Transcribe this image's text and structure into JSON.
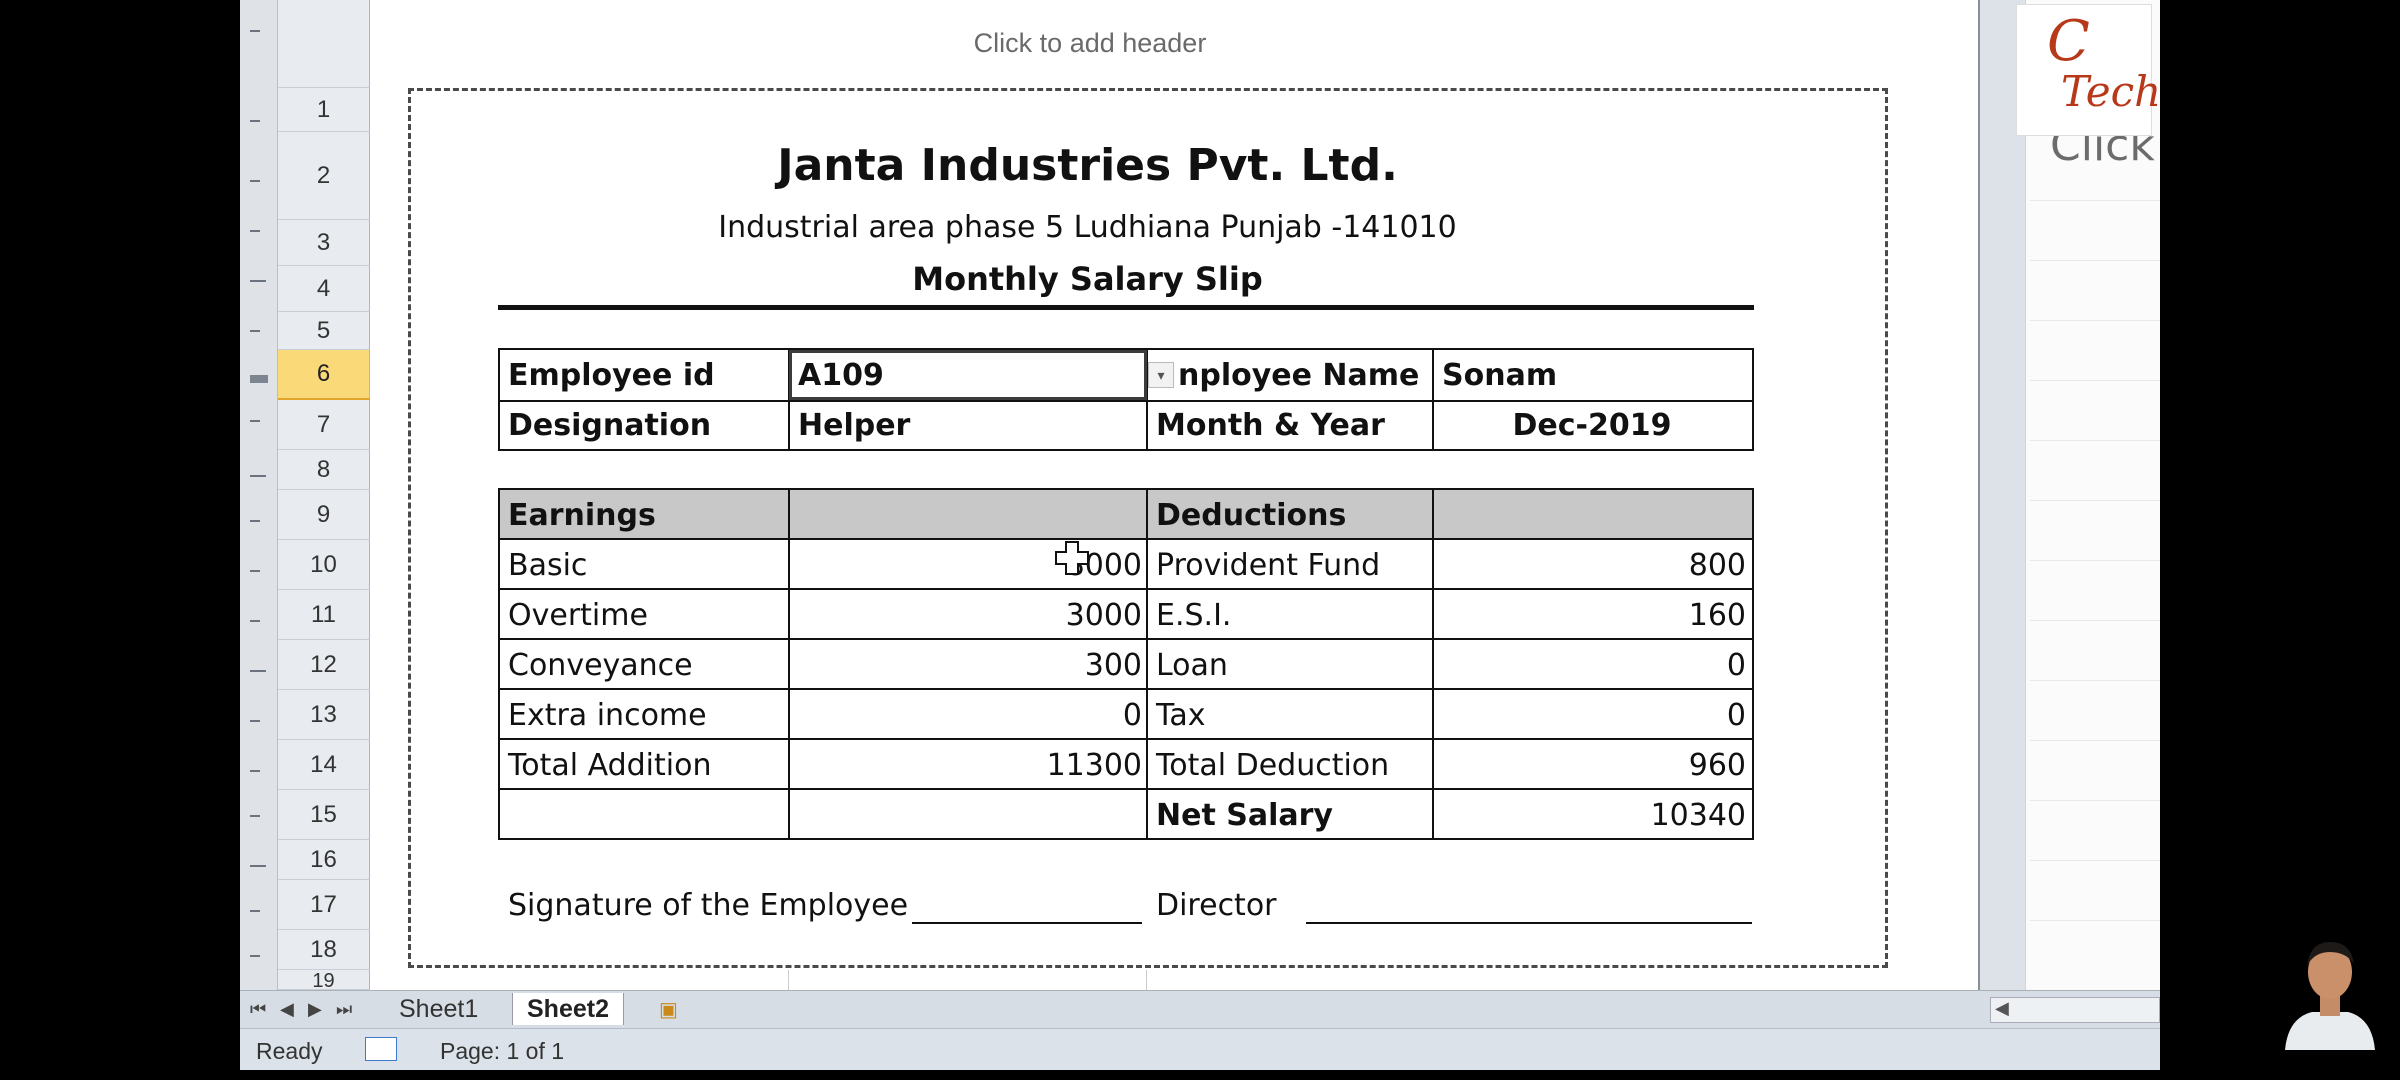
{
  "excel": {
    "header_hint": "Click to add header",
    "right_page_hint": "Click",
    "row_numbers": [
      "1",
      "2",
      "3",
      "4",
      "5",
      "6",
      "7",
      "8",
      "9",
      "10",
      "11",
      "12",
      "13",
      "14",
      "15",
      "16",
      "17",
      "18",
      "19"
    ],
    "active_row": "6"
  },
  "slip": {
    "company": "Janta Industries Pvt. Ltd.",
    "address": "Industrial area phase 5 Ludhiana Punjab -141010",
    "title": "Monthly Salary Slip",
    "employee_id_label": "Employee id",
    "employee_id_value": "A109",
    "employee_name_label": "nployee Name",
    "employee_name_value": "Sonam",
    "designation_label": "Designation",
    "designation_value": "Helper",
    "month_year_label": "Month & Year",
    "month_year_value": "Dec-2019",
    "earnings_header": "Earnings",
    "deductions_header": "Deductions",
    "rows": [
      {
        "earn_label": "Basic",
        "earn_value": "8000",
        "ded_label": "Provident Fund",
        "ded_value": "800"
      },
      {
        "earn_label": "Overtime",
        "earn_value": "3000",
        "ded_label": "E.S.I.",
        "ded_value": "160"
      },
      {
        "earn_label": "Conveyance",
        "earn_value": "300",
        "ded_label": "Loan",
        "ded_value": "0"
      },
      {
        "earn_label": "Extra income",
        "earn_value": "0",
        "ded_label": "Tax",
        "ded_value": "0"
      },
      {
        "earn_label": "Total Addition",
        "earn_value": "11300",
        "ded_label": "Total Deduction",
        "ded_value": "960"
      }
    ],
    "net_salary_label": "Net Salary",
    "net_salary_value": "10340",
    "signature_employee": "Signature of the Employee",
    "director": "Director"
  },
  "tabs": {
    "sheet1": "Sheet1",
    "sheet2": "Sheet2",
    "active": "Sheet2"
  },
  "status": {
    "ready": "Ready",
    "page": "Page: 1 of 1"
  },
  "logo": {
    "letter1": "C",
    "letter2": "Tech"
  }
}
